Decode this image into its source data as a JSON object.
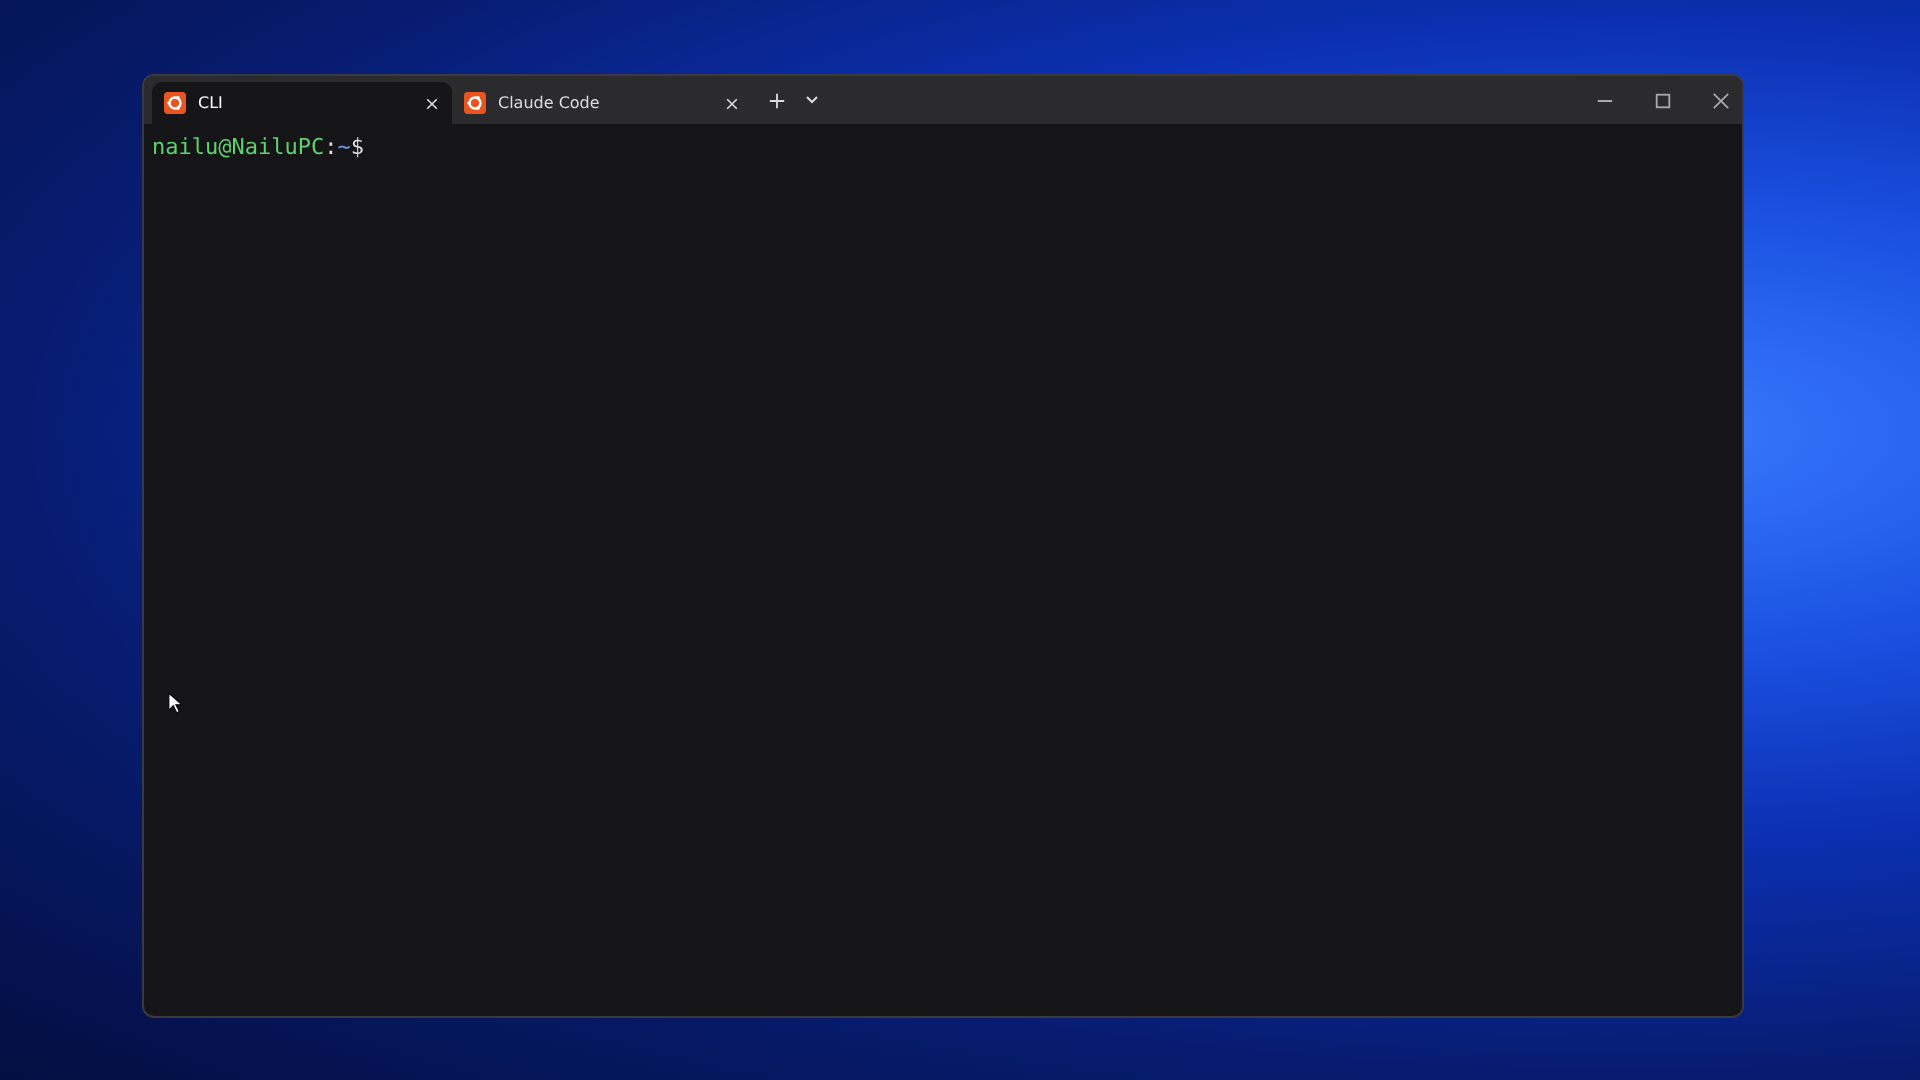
{
  "tabs": [
    {
      "label": "CLI",
      "selected": true
    },
    {
      "label": "Claude Code",
      "selected": false
    }
  ],
  "terminal": {
    "prompt": [
      {
        "kind": "user",
        "text": "nailu@NailuPC"
      },
      {
        "kind": "sep",
        "text": ":"
      },
      {
        "kind": "path",
        "text": "~"
      },
      {
        "kind": "sign",
        "text": "$"
      }
    ]
  }
}
